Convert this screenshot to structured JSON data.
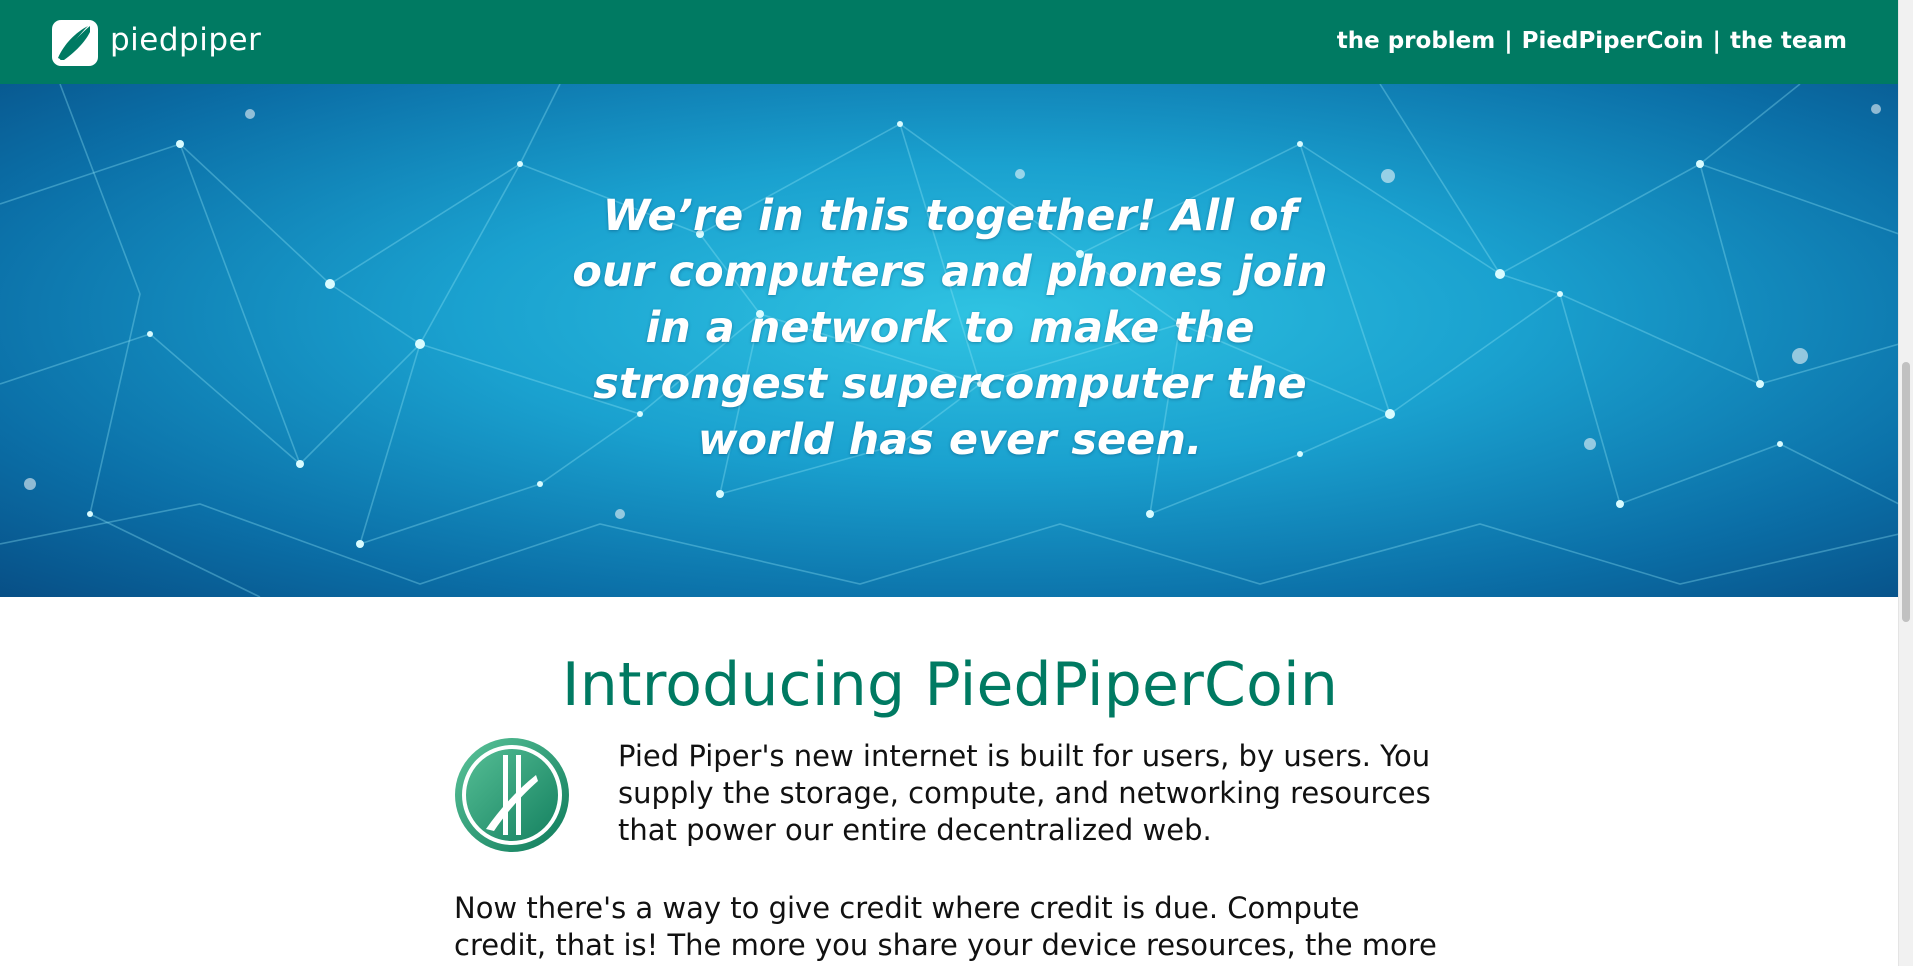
{
  "header": {
    "logo_text": "piedpiper",
    "nav": {
      "items": [
        "the problem",
        "PiedPiperCoin",
        "the team"
      ],
      "separator": "|"
    },
    "bg_color": "#007a62"
  },
  "hero": {
    "quote": "We’re in this together! All of our computers and phones join in a network to make the strongest supercomputer the world has ever seen."
  },
  "content": {
    "title": "Introducing PiedPiperCoin",
    "paragraph1": "Pied Piper's new internet is built for users, by users. You supply the storage, compute, and networking resources that power our entire decentralized web.",
    "paragraph2": "Now there's a way to give credit where credit is due. Compute credit, that is! The more you share your device resources, the more",
    "accent_color": "#007a62"
  },
  "icons": {
    "logo": "piedpiper-logo-icon",
    "coin": "piedpipercoin-icon"
  }
}
